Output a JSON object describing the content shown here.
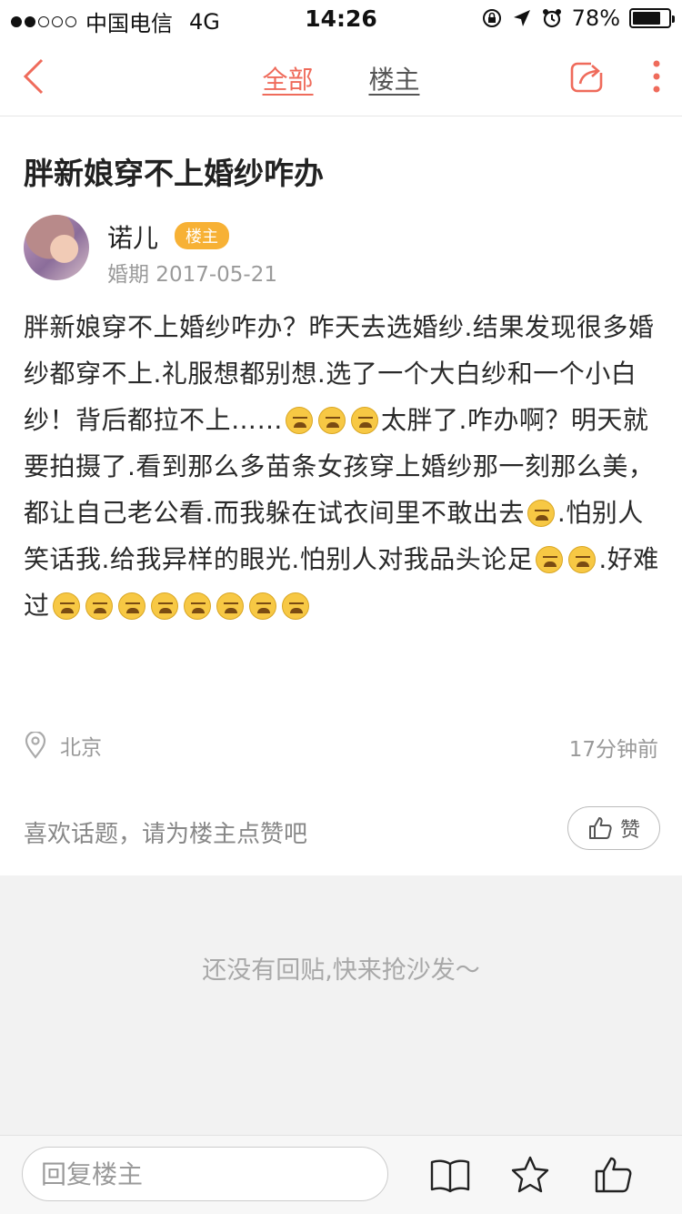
{
  "status_bar": {
    "carrier": "中国电信",
    "network": "4G",
    "time": "14:26",
    "battery": "78%",
    "battery_level": 0.78
  },
  "nav": {
    "tabs": [
      {
        "label": "全部",
        "active": true
      },
      {
        "label": "楼主",
        "active": false
      }
    ],
    "accent_color": "#ef6b5b"
  },
  "post": {
    "title": "胖新娘穿不上婚纱咋办",
    "author": {
      "name": "诺儿",
      "badge": "楼主",
      "wedding_date": "婚期 2017-05-21"
    },
    "body_segments": [
      "胖新娘穿不上婚纱咋办？昨天去选婚纱.结果发现很多婚纱都穿不上.礼服想都别想.选了一个大白纱和一个小白纱！背后都拉不上……",
      "太胖了.咋办啊？明天就要拍摄了.看到那么多苗条女孩穿上婚纱那一刻那么美，都让自己老公看.而我躲在试衣间里不敢出去",
      ".怕别人笑话我.给我异样的眼光.怕别人对我品头论足",
      ".好难过"
    ],
    "location": "北京",
    "time_ago": "17分钟前"
  },
  "like_section": {
    "prompt": "喜欢话题，请为楼主点赞吧",
    "button_label": "赞"
  },
  "replies": {
    "empty_text": "还没有回贴,快来抢沙发～"
  },
  "bottom_bar": {
    "reply_placeholder": "回复楼主",
    "icons": [
      "book-icon",
      "star-icon",
      "thumbs-up-icon"
    ]
  }
}
